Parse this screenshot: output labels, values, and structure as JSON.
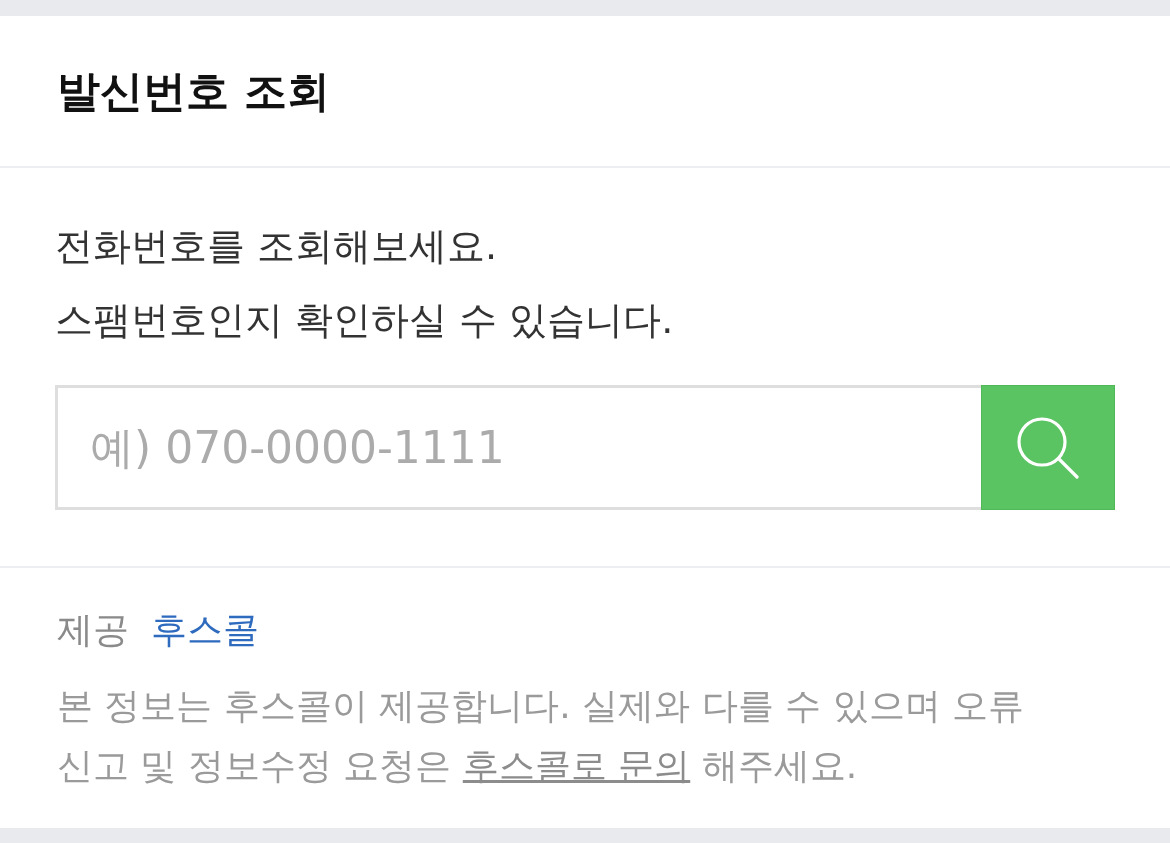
{
  "header": {
    "title": "발신번호 조회"
  },
  "intro": {
    "lines": [
      "전화번호를 조회해보세요.",
      "스팸번호인지 확인하실 수 있습니다."
    ]
  },
  "search": {
    "placeholder": "예) 070-0000-1111"
  },
  "footer": {
    "provider_label": "제공",
    "provider_link": "후스콜",
    "notice": {
      "before": "본 정보는 후스콜이 제공합니다. 실제와 다를 수 있으며 오류 신고 및 정보수정 요청은 ",
      "link": "후스콜로 문의",
      "after": " 해주세요."
    }
  }
}
